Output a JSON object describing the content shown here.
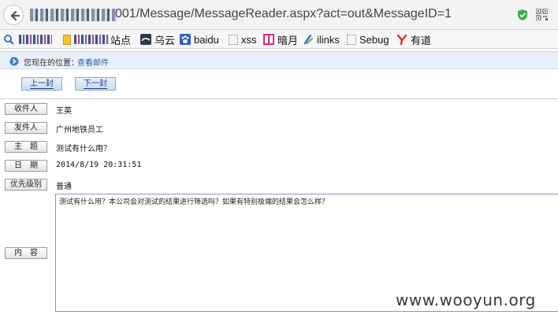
{
  "browser": {
    "url_visible": "001/Message/MessageReader.aspx?act=out&MessageID=1",
    "bookmarks": [
      {
        "label": "站点",
        "icon": "folder-icon"
      },
      {
        "label": "乌云",
        "icon": "wooyun-icon"
      },
      {
        "label": "baidu",
        "icon": "baidu-paw-icon"
      },
      {
        "label": "xss",
        "icon": "blank-page-icon"
      },
      {
        "label": "暗月",
        "icon": "anyue-icon"
      },
      {
        "label": "ilinks",
        "icon": "ilinks-icon"
      },
      {
        "label": "Sebug",
        "icon": "blank-page-icon"
      },
      {
        "label": "有道",
        "icon": "youdao-icon"
      }
    ]
  },
  "location": {
    "label": "您现在的位置：",
    "current": "查看邮件"
  },
  "nav": {
    "prev_label": "上一封",
    "next_label": "下一封"
  },
  "message": {
    "recipient_label": "收件人",
    "recipient": "王英",
    "sender_label": "发件人",
    "sender": "广州地铁员工",
    "subject_label": "主　题",
    "subject": "测试有什么用？",
    "date_label": "日　期",
    "date": "2014/8/19 20:31:51",
    "priority_label": "优先级别",
    "priority": "普通",
    "content_label": "内　容",
    "content": "测试有什么用？本公司会对测试的结果进行筛选吗？如果有特别极端的结果会怎么样？"
  },
  "watermark": "www.wooyun.org"
}
